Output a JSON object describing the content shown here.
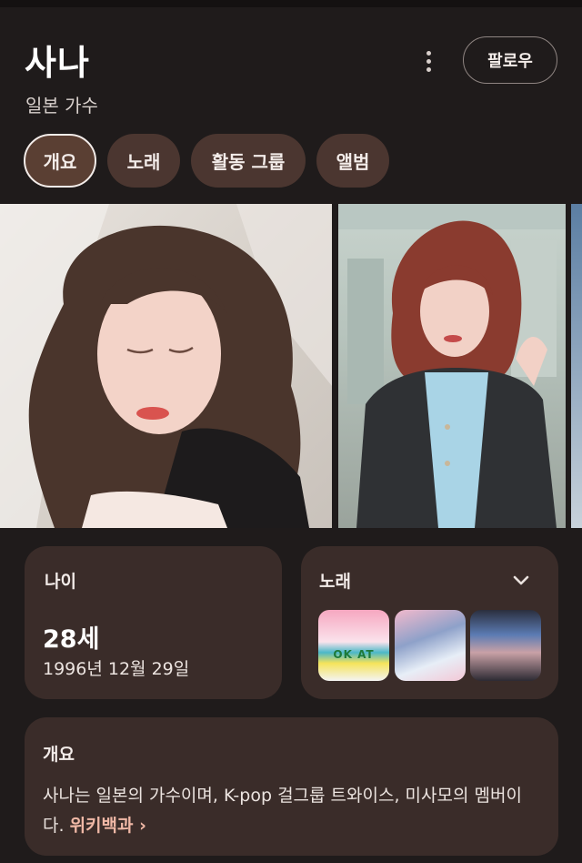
{
  "header": {
    "title": "사나",
    "subtitle": "일본 가수",
    "follow_label": "팔로우",
    "more_icon": "more-vert-icon"
  },
  "tabs": [
    {
      "label": "개요",
      "active": true
    },
    {
      "label": "노래",
      "active": false
    },
    {
      "label": "활동 그룹",
      "active": false
    },
    {
      "label": "앨범",
      "active": false
    }
  ],
  "photos": [
    {
      "description_icon": "portrait-photo"
    },
    {
      "description_icon": "event-photo"
    },
    {
      "description_icon": "partial-photo"
    }
  ],
  "age_card": {
    "label": "나이",
    "value": "28세",
    "birth_date": "1996년 12월 29일"
  },
  "songs_card": {
    "label": "노래",
    "thumb1_text": "OK AT"
  },
  "overview_card": {
    "label": "개요",
    "text": "사나는 일본의 가수이며, K-pop 걸그룹 트와이스, 미사모의 멤버이다.",
    "link_label": "위키백과"
  },
  "colors": {
    "background": "#1f1b1b",
    "card": "#3a2c29",
    "chip": "#4b3630",
    "link": "#f0b8a6"
  }
}
